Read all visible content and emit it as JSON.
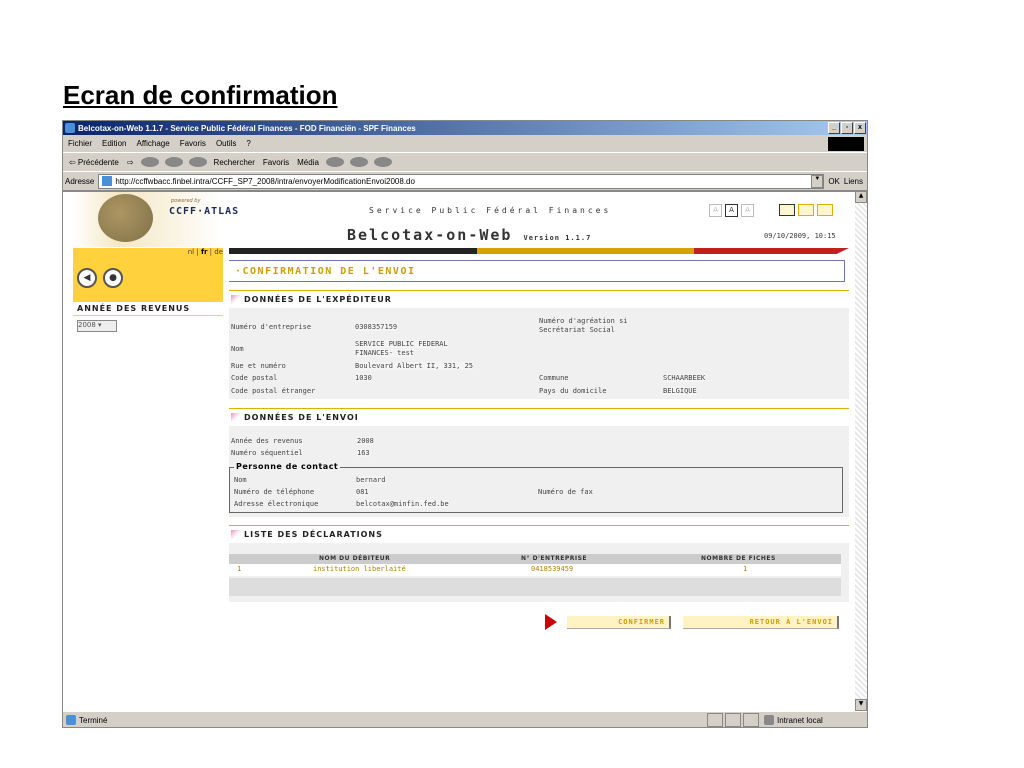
{
  "slide_title": "Ecran de confirmation",
  "window": {
    "title": "Belcotax-on-Web 1.1.7 - Service Public Fédéral Finances - FOD Financiën - SPF Finances",
    "min": "_",
    "max": "▫",
    "close": "x"
  },
  "menu": [
    "Fichier",
    "Edition",
    "Affichage",
    "Favoris",
    "Outils",
    "?"
  ],
  "toolbar": {
    "back": "⇦ Précédente",
    "search": "Rechercher",
    "favorites": "Favoris",
    "media": "Média"
  },
  "address": {
    "label": "Adresse",
    "url": "http://ccffwbacc.finbel.intra/CCFF_SP7_2008/intra/envoyerModificationEnvoi2008.do",
    "go": "OK",
    "links": "Liens"
  },
  "header": {
    "powered_by": "powered by",
    "ccff": "CCFF·ATLAS",
    "service": "Service Public Fédéral Finances",
    "app": "Belcotax-on-Web",
    "version": "Version 1.1.7",
    "datetime": "09/10/2009, 10:15",
    "font_sizes": [
      "A",
      "A",
      "A"
    ]
  },
  "lang": {
    "nl": "nl",
    "fr": "fr",
    "de": "de"
  },
  "left": {
    "annee_label": "ANNÉE DES REVENUS",
    "annee_value": "2008"
  },
  "page_title": "·CONFIRMATION DE L'ENVOI",
  "expediteur": {
    "title": "DONNÉES DE L'EXPÉDITEUR",
    "num_entreprise_label": "Numéro d'entreprise",
    "num_entreprise": "0308357159",
    "agreation_label1": "Numéro d'agréation si",
    "agreation_label2": "Secrétariat Social",
    "nom_label": "Nom",
    "nom1": "SERVICE PUBLIC FEDERAL",
    "nom2": "FINANCES- test",
    "rue_label": "Rue et numéro",
    "rue": "Boulevard Albert II, 331, 25",
    "cp_label": "Code postal",
    "cp": "1030",
    "commune_label": "Commune",
    "commune": "SCHAARBEEK",
    "cp_etr_label": "Code postal étranger",
    "pays_label": "Pays du domicile",
    "pays": "BELGIQUE"
  },
  "envoi": {
    "title": "DONNÉES DE L'ENVOI",
    "annee_label": "Année des revenus",
    "annee": "2008",
    "seq_label": "Numéro séquentiel",
    "seq": "163",
    "contact_title": "Personne de contact",
    "nom_label": "Nom",
    "nom": "bernard",
    "tel_label": "Numéro de téléphone",
    "tel": "081",
    "fax_label": "Numéro de fax",
    "email_label": "Adresse électronique",
    "email": "belcotax@minfin.fed.be"
  },
  "declarations": {
    "title": "LISTE DES DÉCLARATIONS",
    "columns": [
      "NOM DU DÉBITEUR",
      "N° D'ENTREPRISE",
      "NOMBRE DE FICHES"
    ],
    "rows": [
      {
        "idx": "1",
        "nom": "institution liberlaité",
        "num": "0418539459",
        "fiches": "1"
      }
    ]
  },
  "buttons": {
    "confirmer": "CONFIRMER",
    "retour": "RETOUR À L'ENVOI"
  },
  "status": {
    "text": "Terminé",
    "zone": "Intranet local"
  }
}
